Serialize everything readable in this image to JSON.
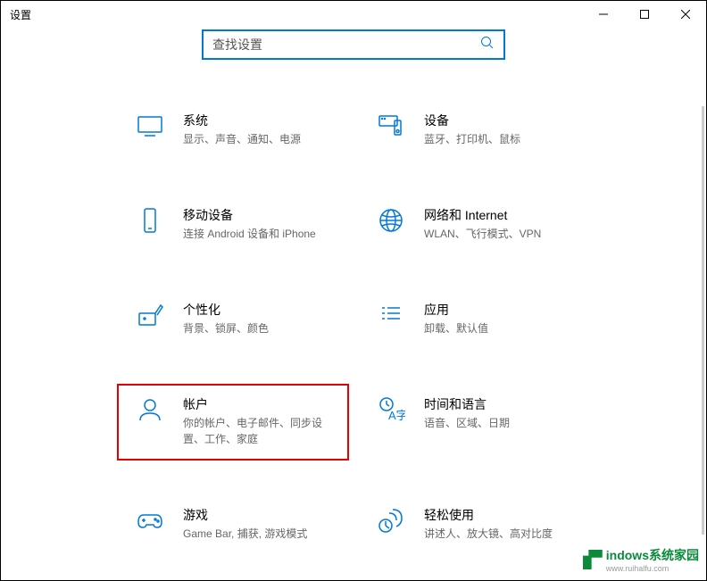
{
  "window": {
    "title": "设置"
  },
  "search": {
    "placeholder": "查找设置"
  },
  "categories": [
    {
      "key": "system",
      "title": "系统",
      "subtitle": "显示、声音、通知、电源"
    },
    {
      "key": "devices",
      "title": "设备",
      "subtitle": "蓝牙、打印机、鼠标"
    },
    {
      "key": "phone",
      "title": "移动设备",
      "subtitle": "连接 Android 设备和 iPhone"
    },
    {
      "key": "network",
      "title": "网络和 Internet",
      "subtitle": "WLAN、飞行模式、VPN"
    },
    {
      "key": "personalization",
      "title": "个性化",
      "subtitle": "背景、锁屏、颜色"
    },
    {
      "key": "apps",
      "title": "应用",
      "subtitle": "卸载、默认值"
    },
    {
      "key": "accounts",
      "title": "帐户",
      "subtitle": "你的帐户、电子邮件、同步设置、工作、家庭"
    },
    {
      "key": "time",
      "title": "时间和语言",
      "subtitle": "语音、区域、日期"
    },
    {
      "key": "gaming",
      "title": "游戏",
      "subtitle": "Game Bar, 捕获, 游戏模式"
    },
    {
      "key": "ease",
      "title": "轻松使用",
      "subtitle": "讲述人、放大镜、高对比度"
    }
  ],
  "watermark": {
    "brand": "indows系统家园",
    "url": "www.ruihalfu.com"
  }
}
